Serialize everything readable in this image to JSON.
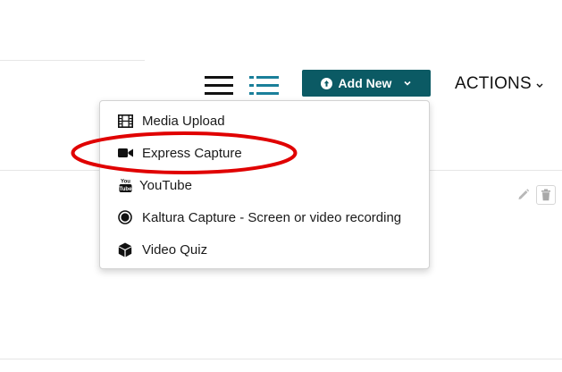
{
  "toolbar": {
    "add_new_label": "Add New",
    "actions_label": "ACTIONS"
  },
  "add_new_menu": {
    "items": [
      {
        "label": "Media Upload",
        "icon": "film-icon"
      },
      {
        "label": "Express Capture",
        "icon": "video-camera-icon"
      },
      {
        "label": "YouTube",
        "icon": "youtube-icon"
      },
      {
        "label": "Kaltura Capture - Screen or video recording",
        "icon": "record-icon"
      },
      {
        "label": "Video Quiz",
        "icon": "cube-icon"
      }
    ],
    "highlighted_item": "Express Capture"
  },
  "colors": {
    "add_new_bg": "#0b5a64",
    "list_view_active": "#1a7f9a",
    "highlight_ring": "#e00000"
  }
}
